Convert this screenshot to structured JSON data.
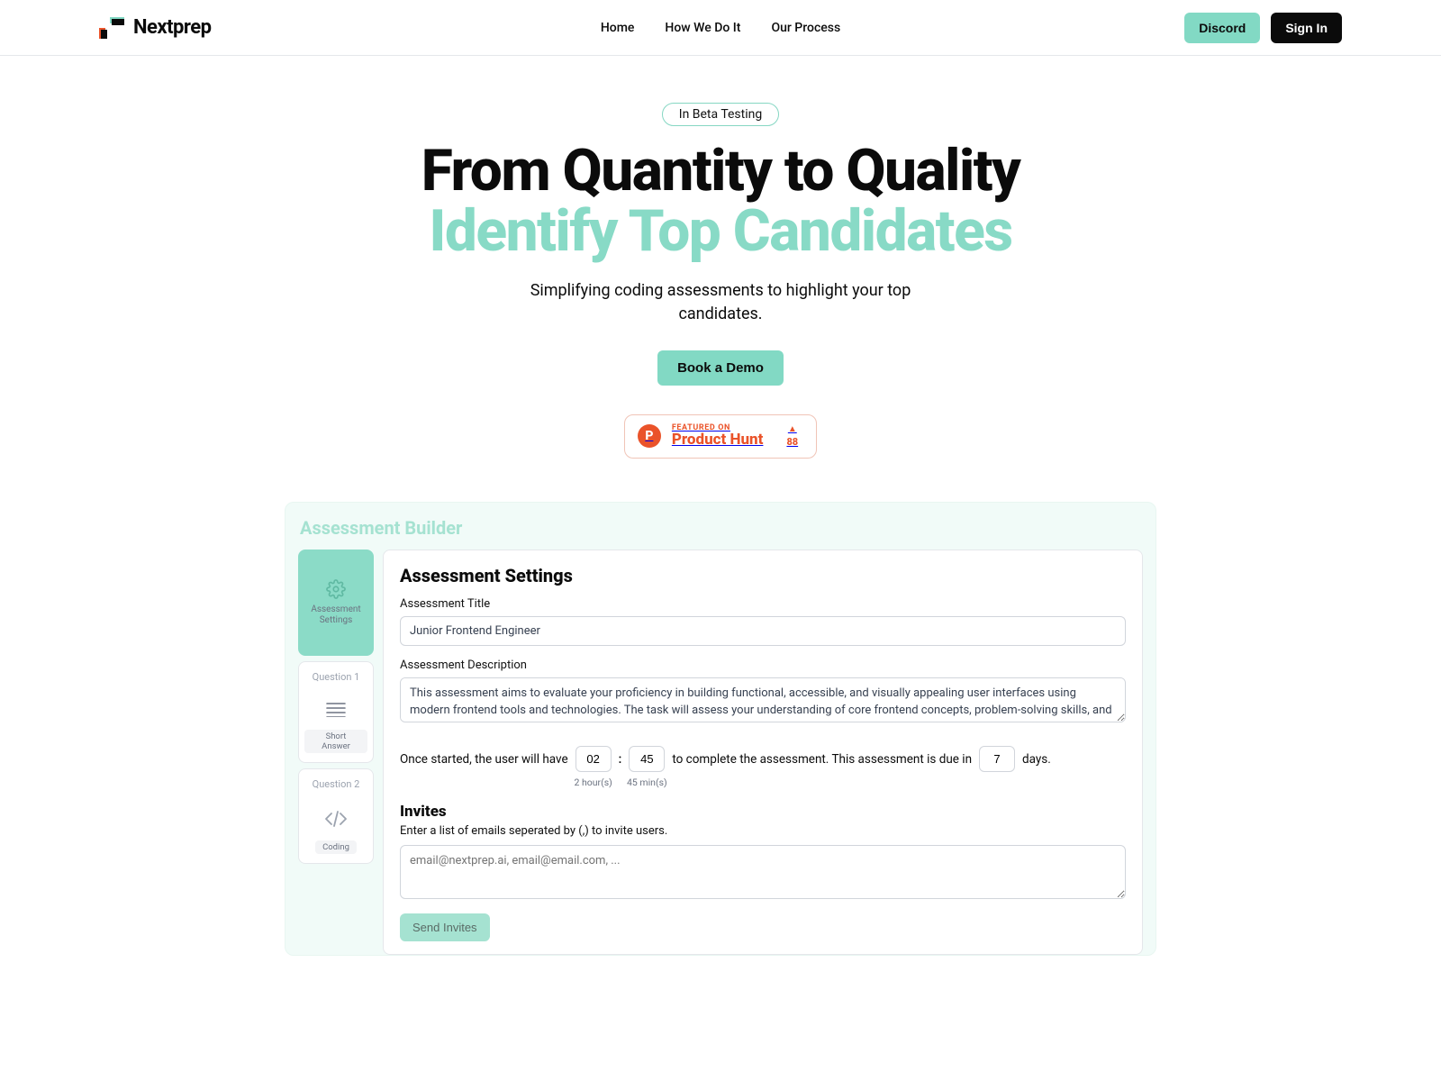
{
  "brand": {
    "name": "Nextprep"
  },
  "nav": {
    "home": "Home",
    "how": "How We Do It",
    "process": "Our Process"
  },
  "header_actions": {
    "discord": "Discord",
    "signin": "Sign In"
  },
  "hero": {
    "badge": "In Beta Testing",
    "title_line1": "From Quantity to Quality",
    "title_line2": "Identify Top Candidates",
    "subtitle": "Simplifying coding assessments to highlight your top candidates.",
    "cta": "Book a Demo"
  },
  "product_hunt": {
    "featured": "FEATURED ON",
    "name": "Product Hunt",
    "count": "88"
  },
  "builder": {
    "title": "Assessment Builder",
    "side": {
      "settings": "Assessment Settings",
      "q1": {
        "title": "Question 1",
        "tag": "Short Answer"
      },
      "q2": {
        "title": "Question 2",
        "tag": "Coding"
      }
    },
    "settings": {
      "heading": "Assessment Settings",
      "title_label": "Assessment Title",
      "title_value": "Junior Frontend Engineer",
      "desc_label": "Assessment Description",
      "desc_value": "This assessment aims to evaluate your proficiency in building functional, accessible, and visually appealing user interfaces using modern frontend tools and technologies. The task will assess your understanding of core frontend concepts, problem-solving skills, and ability to create modular, maintainable code.",
      "time_prefix": "Once started, the user will have",
      "hours": "02",
      "hours_sub": "2 hour(s)",
      "mins": "45",
      "mins_sub": "45 min(s)",
      "time_mid": "to complete the assessment. This assessment is due in",
      "days": "7",
      "time_suffix": "days."
    },
    "invites": {
      "heading": "Invites",
      "label": "Enter a list of emails seperated by (,) to invite users.",
      "placeholder": "email@nextprep.ai, email@email.com, ...",
      "send": "Send Invites"
    }
  }
}
